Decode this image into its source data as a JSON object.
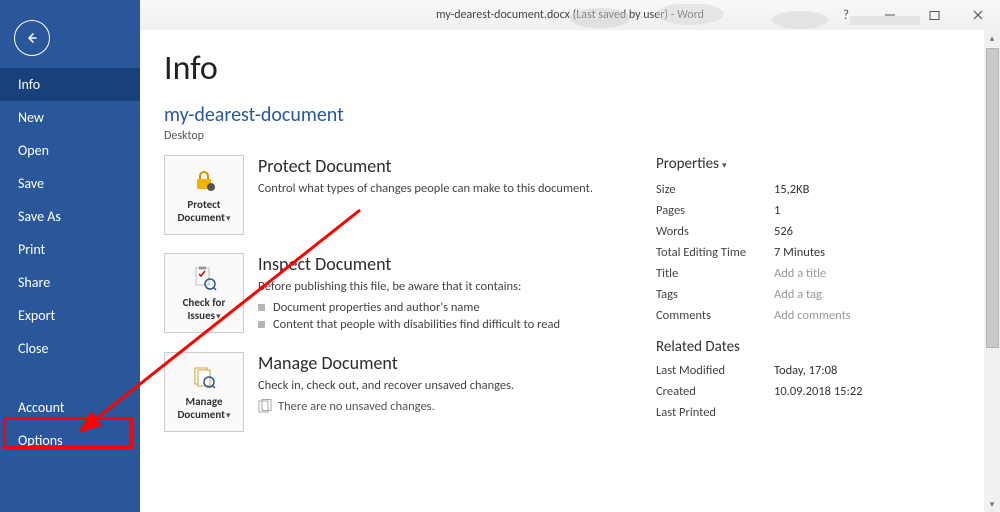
{
  "titlebar": {
    "title": "my-dearest-document.docx (Last saved by user) - Word"
  },
  "sidebar": {
    "items": [
      {
        "label": "Info",
        "selected": true
      },
      {
        "label": "New"
      },
      {
        "label": "Open"
      },
      {
        "label": "Save"
      },
      {
        "label": "Save As"
      },
      {
        "label": "Print"
      },
      {
        "label": "Share"
      },
      {
        "label": "Export"
      },
      {
        "label": "Close"
      },
      {
        "label": "Account"
      },
      {
        "label": "Options"
      }
    ]
  },
  "page": {
    "title": "Info",
    "doc_name": "my-dearest-document",
    "doc_location": "Desktop"
  },
  "actions": {
    "protect": {
      "button": "Protect Document",
      "heading": "Protect Document",
      "desc": "Control what types of changes people can make to this document."
    },
    "inspect": {
      "button": "Check for Issues",
      "heading": "Inspect Document",
      "desc": "Before publishing this file, be aware that it contains:",
      "items": [
        "Document properties and author's name",
        "Content that people with disabilities find difficult to read"
      ]
    },
    "manage": {
      "button": "Manage Document",
      "heading": "Manage Document",
      "desc": "Check in, check out, and recover unsaved changes.",
      "no_changes": "There are no unsaved changes."
    }
  },
  "properties": {
    "header": "Properties",
    "rows": [
      {
        "label": "Size",
        "value": "15,2KB"
      },
      {
        "label": "Pages",
        "value": "1"
      },
      {
        "label": "Words",
        "value": "526"
      },
      {
        "label": "Total Editing Time",
        "value": "7 Minutes"
      },
      {
        "label": "Title",
        "value": "Add a title",
        "placeholder": true
      },
      {
        "label": "Tags",
        "value": "Add a tag",
        "placeholder": true
      },
      {
        "label": "Comments",
        "value": "Add comments",
        "placeholder": true
      }
    ],
    "dates_header": "Related Dates",
    "dates": [
      {
        "label": "Last Modified",
        "value": "Today, 17:08"
      },
      {
        "label": "Created",
        "value": "10.09.2018 15:22"
      },
      {
        "label": "Last Printed",
        "value": ""
      }
    ]
  }
}
